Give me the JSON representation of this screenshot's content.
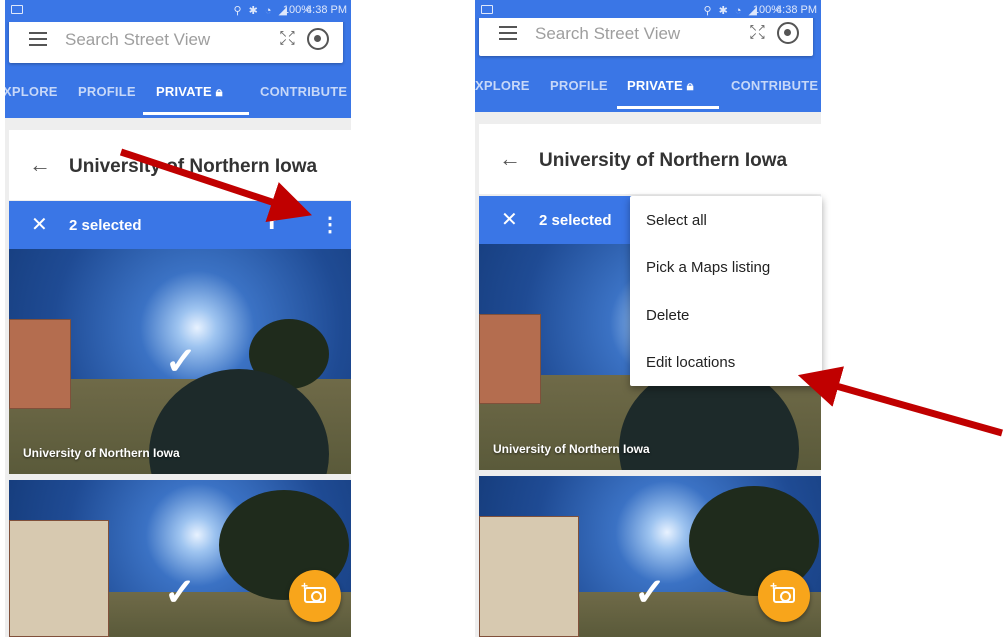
{
  "status_bar": {
    "time": "4:38 PM",
    "battery": "100%"
  },
  "search": {
    "placeholder": "Search Street View"
  },
  "tabs": [
    "XPLORE",
    "PROFILE",
    "PRIVATE",
    "CONTRIBUTE"
  ],
  "active_tab": "PRIVATE",
  "card": {
    "title": "University of Northern Iowa"
  },
  "selection": {
    "count_label": "2 selected"
  },
  "photos": [
    {
      "label": "University of Northern Iowa",
      "selected": true
    },
    {
      "label": "",
      "selected": true
    }
  ],
  "overflow_menu": {
    "items": [
      "Select all",
      "Pick a Maps listing",
      "Delete",
      "Edit locations"
    ]
  },
  "colors": {
    "accent": "#3a76e6",
    "fab": "#f8a51b",
    "annotation_arrow": "#c00000"
  },
  "icons": [
    "menu-icon",
    "expand-icon",
    "my-location-icon",
    "lock-icon",
    "back-arrow-icon",
    "close-icon",
    "upload-icon",
    "more-vert-icon",
    "checkmark-icon",
    "add-photo-icon"
  ]
}
